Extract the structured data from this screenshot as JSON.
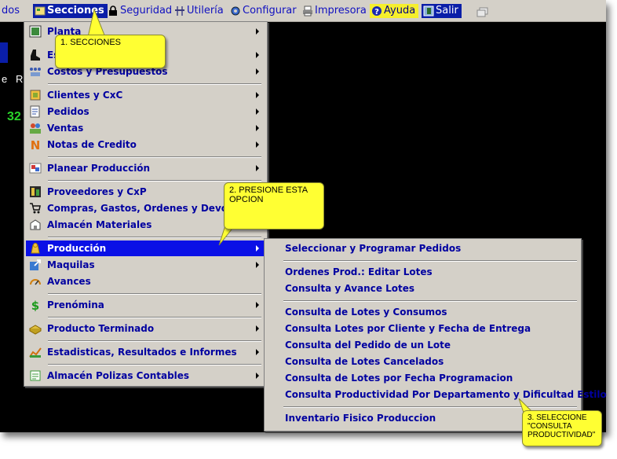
{
  "menubar": {
    "items": [
      {
        "label": "dos",
        "icon": "none"
      },
      {
        "label": "Secciones",
        "icon": "sections-icon",
        "active": true
      },
      {
        "label": "Seguridad",
        "icon": "lock-icon"
      },
      {
        "label": "Utilería",
        "icon": "tools-icon"
      },
      {
        "label": "Configurar",
        "icon": "gear-icon"
      },
      {
        "label": "Impresora",
        "icon": "printer-icon"
      },
      {
        "label": "Ayuda",
        "icon": "help-icon"
      },
      {
        "label": "Salir",
        "icon": "exit-icon"
      }
    ]
  },
  "background": {
    "fragment_e": "e",
    "fragment_r": "R",
    "fragment_num": "32"
  },
  "sections_menu": {
    "items": [
      {
        "label": "Planta",
        "icon": "plant-icon",
        "has_submenu": true
      },
      {
        "label": "Es",
        "icon": "boot-icon",
        "has_submenu": true
      },
      {
        "label": "Costos y Presupuestos",
        "icon": "costs-icon",
        "has_submenu": true
      },
      {
        "label": "Clientes y CxC",
        "icon": "clients-icon",
        "has_submenu": true
      },
      {
        "label": "Pedidos",
        "icon": "orders-icon",
        "has_submenu": true
      },
      {
        "label": "Ventas",
        "icon": "sales-icon",
        "has_submenu": true
      },
      {
        "label": "Notas de Credito",
        "icon": "credit-note-icon",
        "has_submenu": true
      },
      {
        "label": "Planear Producción",
        "icon": "plan-icon",
        "has_submenu": true
      },
      {
        "label": "Proveedores y CxP",
        "icon": "suppliers-icon",
        "has_submenu": false
      },
      {
        "label": "Compras, Gastos, Ordenes y Devolucion",
        "icon": "cart-icon",
        "has_submenu": false
      },
      {
        "label": "Almacén Materiales",
        "icon": "warehouse-icon",
        "has_submenu": false
      },
      {
        "label": "Producción",
        "icon": "production-icon",
        "has_submenu": true,
        "selected": true
      },
      {
        "label": "Maquilas",
        "icon": "maquilas-icon",
        "has_submenu": true
      },
      {
        "label": "Avances",
        "icon": "progress-icon",
        "has_submenu": false
      },
      {
        "label": "Prenómina",
        "icon": "payroll-icon",
        "has_submenu": true
      },
      {
        "label": "Producto Terminado",
        "icon": "finished-product-icon",
        "has_submenu": true
      },
      {
        "label": "Estadisticas, Resultados e Informes",
        "icon": "stats-icon",
        "has_submenu": true
      },
      {
        "label": "Almacén Polizas Contables",
        "icon": "accounting-icon",
        "has_submenu": true
      }
    ]
  },
  "production_menu": {
    "items": [
      {
        "label": "Seleccionar y Programar Pedidos"
      },
      {
        "label": "Ordenes Prod.: Editar Lotes"
      },
      {
        "label": "Consulta y Avance Lotes"
      },
      {
        "label": "Consulta de Lotes y Consumos"
      },
      {
        "label": "Consulta Lotes por Cliente y Fecha de Entrega"
      },
      {
        "label": "Consulta del Pedido de un Lote"
      },
      {
        "label": "Consulta de Lotes Cancelados"
      },
      {
        "label": "Consulta de Lotes por Fecha Programacion"
      },
      {
        "label": "Consulta Productividad Por Departamento y Dificultad Estilo"
      },
      {
        "label": "Inventario Fisico Produccion"
      }
    ]
  },
  "callouts": {
    "step1": "1. SECCIONES",
    "step2": "2. PRESIONE ESTA OPCION",
    "step3": "3. SELECCIONE \"CONSULTA PRODUCTIVIDAD\""
  },
  "colors": {
    "menu_bg": "#d4d0c8",
    "menu_text": "#0000a0",
    "highlight": "#0a10e6",
    "callout": "#ffff33"
  }
}
